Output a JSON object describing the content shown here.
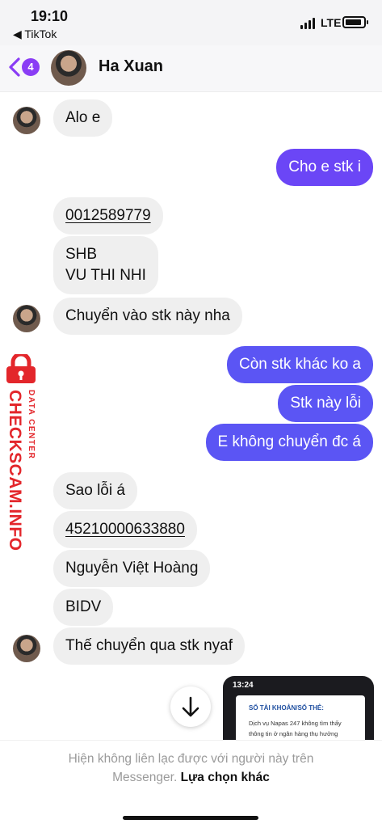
{
  "status_bar": {
    "time": "19:10",
    "back_app": "◀ TikTok",
    "network": "LTE"
  },
  "header": {
    "unread_count": "4",
    "contact_name": "Ha Xuan"
  },
  "messages": [
    {
      "side": "in",
      "text": "Alo e"
    },
    {
      "side": "out",
      "text": "Cho e stk i"
    },
    {
      "side": "in",
      "text": "0012589779"
    },
    {
      "side": "in",
      "line1": "SHB",
      "line2": "VU THI NHI"
    },
    {
      "side": "in",
      "text": "Chuyển vào stk này nha"
    },
    {
      "side": "out",
      "text": "Còn stk khác ko a"
    },
    {
      "side": "out",
      "text": "Stk này lỗi"
    },
    {
      "side": "out",
      "text": "E không chuyển đc á"
    },
    {
      "side": "in",
      "text": "Sao lỗi á"
    },
    {
      "side": "in",
      "text": "45210000633880"
    },
    {
      "side": "in",
      "text": "Nguyễn Việt Hoàng"
    },
    {
      "side": "in",
      "text": "BIDV"
    },
    {
      "side": "in",
      "text": "Thế chuyển qua stk nyaf"
    }
  ],
  "watermark": {
    "main": "CHECKSCAM.INFO",
    "sub": "DATA CENTER"
  },
  "attachment": {
    "time": "13:24",
    "title": "SỐ TÀI KHOẢN/SỐ THẺ:",
    "body": "Dịch vụ Napas 247 không tìm thấy thông tin ở ngân hàng thụ hưởng"
  },
  "footer": {
    "line1": "Hiện không liên lạc được với người này trên",
    "line2": "Messenger.",
    "link": "Lựa chọn khác"
  },
  "colors": {
    "outgoing": "#6b46f6",
    "incoming": "#efefef",
    "badge": "#8a3df5",
    "watermark": "#e3262b"
  },
  "icons": [
    "back-chevron-icon",
    "signal-icon",
    "battery-icon",
    "arrow-down-icon",
    "lock-icon"
  ]
}
